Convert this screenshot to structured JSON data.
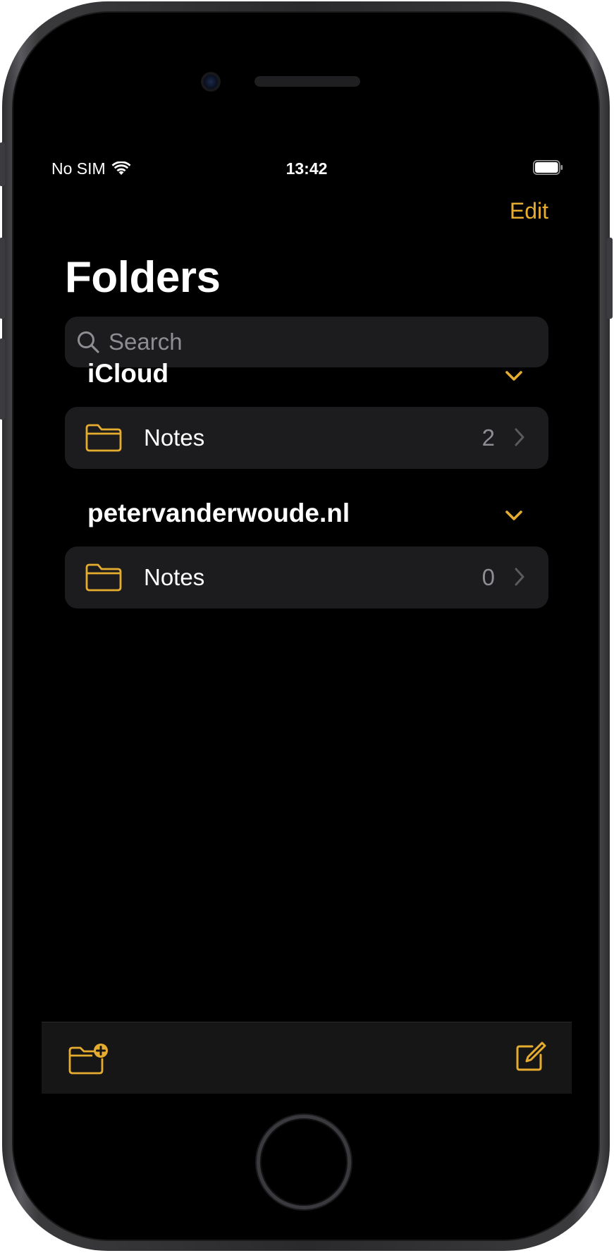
{
  "status_bar": {
    "carrier": "No SIM",
    "time": "13:42"
  },
  "nav": {
    "edit_label": "Edit",
    "title": "Folders"
  },
  "search": {
    "placeholder": "Search"
  },
  "sections": [
    {
      "name": "iCloud",
      "folders": [
        {
          "name": "Notes",
          "count": "2"
        }
      ]
    },
    {
      "name": "petervanderwoude.nl",
      "folders": [
        {
          "name": "Notes",
          "count": "0"
        }
      ]
    }
  ],
  "toolbar": {
    "left_icon": "new-folder-icon",
    "right_icon": "compose-icon"
  },
  "colors": {
    "accent": "#e5ac2f",
    "background": "#000000",
    "cell": "#1c1c1e",
    "secondary_text": "#8d8d93"
  }
}
